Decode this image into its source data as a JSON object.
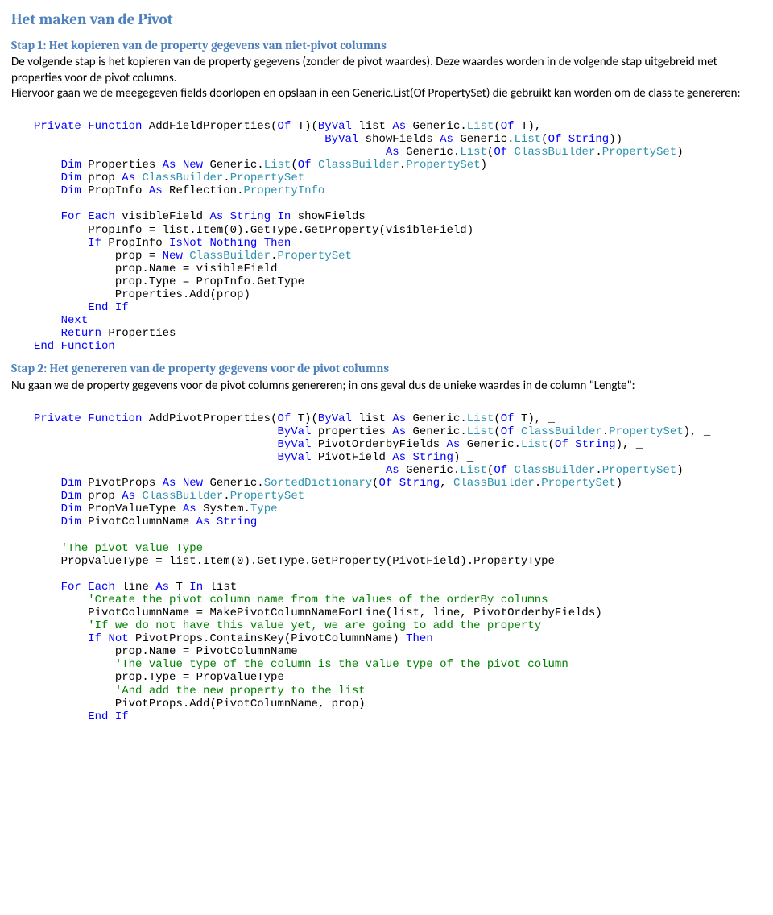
{
  "h2": "Het maken van de Pivot",
  "s1_h3": "Stap 1: Het kopieren van de property gegevens van niet-pivot columns",
  "s1_p": "De volgende stap is het kopieren van de property gegevens (zonder de pivot waardes). Deze waardes worden in de volgende stap uitgebreid met properties voor de pivot columns.\nHiervoor gaan we de meegegeven fields doorlopen en opslaan in een Generic.List(Of PropertySet) die gebruikt kan worden om de class te genereren:",
  "s2_h3": "Stap 2: Het genereren van de property gegevens voor de pivot columns",
  "s2_p": "Nu gaan we de property gegevens voor de pivot columns genereren; in ons geval dus de unieke waardes in de column \"Lengte\":",
  "c1": {
    "l1_a": "Private",
    "l1_b": "Function",
    "l1_c": " AddFieldProperties(",
    "l1_d": "Of",
    "l1_e": " T)(",
    "l1_f": "ByVal",
    "l1_g": " list ",
    "l1_h": "As",
    "l1_i": " Generic.",
    "l1_j": "List",
    "l1_k": "(",
    "l1_l": "Of",
    "l1_m": " T), _",
    "l2_a": "ByVal",
    "l2_b": " showFields ",
    "l2_c": "As",
    "l2_d": " Generic.",
    "l2_e": "List",
    "l2_f": "(",
    "l2_g": "Of",
    "l2_h": " ",
    "l2_i": "String",
    "l2_j": ")) _",
    "l3_a": "As",
    "l3_b": " Generic.",
    "l3_c": "List",
    "l3_d": "(",
    "l3_e": "Of",
    "l3_f": " ",
    "l3_g": "ClassBuilder",
    "l3_h": ".",
    "l3_i": "PropertySet",
    "l3_j": ")",
    "l4_a": "Dim",
    "l4_b": " Properties ",
    "l4_c": "As",
    "l4_d": " ",
    "l4_e": "New",
    "l4_f": " Generic.",
    "l4_g": "List",
    "l4_h": "(",
    "l4_i": "Of",
    "l4_j": " ",
    "l4_k": "ClassBuilder",
    "l4_l": ".",
    "l4_m": "PropertySet",
    "l4_n": ")",
    "l5_a": "Dim",
    "l5_b": " prop ",
    "l5_c": "As",
    "l5_d": " ",
    "l5_e": "ClassBuilder",
    "l5_f": ".",
    "l5_g": "PropertySet",
    "l6_a": "Dim",
    "l6_b": " PropInfo ",
    "l6_c": "As",
    "l6_d": " Reflection.",
    "l6_e": "PropertyInfo",
    "l7_a": "For",
    "l7_b": " ",
    "l7_c": "Each",
    "l7_d": " visibleField ",
    "l7_e": "As",
    "l7_f": " ",
    "l7_g": "String",
    "l7_h": " ",
    "l7_i": "In",
    "l7_j": " showFields",
    "l8": "PropInfo = list.Item(0).GetType.GetProperty(visibleField)",
    "l9_a": "If",
    "l9_b": " PropInfo ",
    "l9_c": "IsNot",
    "l9_d": " ",
    "l9_e": "Nothing",
    "l9_f": " ",
    "l9_g": "Then",
    "l10_a": "prop = ",
    "l10_b": "New",
    "l10_c": " ",
    "l10_d": "ClassBuilder",
    "l10_e": ".",
    "l10_f": "PropertySet",
    "l11": "prop.Name = visibleField",
    "l12": "prop.Type = PropInfo.GetType",
    "l13": "Properties.Add(prop)",
    "l14_a": "End",
    "l14_b": " ",
    "l14_c": "If",
    "l15": "Next",
    "l16_a": "Return",
    "l16_b": " Properties",
    "l17_a": "End",
    "l17_b": " ",
    "l17_c": "Function"
  },
  "c2": {
    "l1_a": "Private",
    "l1_b": "Function",
    "l1_c": " AddPivotProperties(",
    "l1_d": "Of",
    "l1_e": " T)(",
    "l1_f": "ByVal",
    "l1_g": " list ",
    "l1_h": "As",
    "l1_i": " Generic.",
    "l1_j": "List",
    "l1_k": "(",
    "l1_l": "Of",
    "l1_m": " T), _",
    "l2_a": "ByVal",
    "l2_b": " properties ",
    "l2_c": "As",
    "l2_d": " Generic.",
    "l2_e": "List",
    "l2_f": "(",
    "l2_g": "Of",
    "l2_h": " ",
    "l2_i": "ClassBuilder",
    "l2_j": ".",
    "l2_k": "PropertySet",
    "l2_l": "), _",
    "l3_a": "ByVal",
    "l3_b": " PivotOrderbyFields ",
    "l3_c": "As",
    "l3_d": " Generic.",
    "l3_e": "List",
    "l3_f": "(",
    "l3_g": "Of",
    "l3_h": " ",
    "l3_i": "String",
    "l3_j": "), _",
    "l4_a": "ByVal",
    "l4_b": " PivotField ",
    "l4_c": "As",
    "l4_d": " ",
    "l4_e": "String",
    "l4_f": ") _",
    "l5_a": "As",
    "l5_b": " Generic.",
    "l5_c": "List",
    "l5_d": "(",
    "l5_e": "Of",
    "l5_f": " ",
    "l5_g": "ClassBuilder",
    "l5_h": ".",
    "l5_i": "PropertySet",
    "l5_j": ")",
    "l6_a": "Dim",
    "l6_b": " PivotProps ",
    "l6_c": "As",
    "l6_d": " ",
    "l6_e": "New",
    "l6_f": " Generic.",
    "l6_g": "SortedDictionary",
    "l6_h": "(",
    "l6_i": "Of",
    "l6_j": " ",
    "l6_k": "String",
    "l6_l": ", ",
    "l6_m": "ClassBuilder",
    "l6_n": ".",
    "l6_o": "PropertySet",
    "l6_p": ")",
    "l7_a": "Dim",
    "l7_b": " prop ",
    "l7_c": "As",
    "l7_d": " ",
    "l7_e": "ClassBuilder",
    "l7_f": ".",
    "l7_g": "PropertySet",
    "l8_a": "Dim",
    "l8_b": " PropValueType ",
    "l8_c": "As",
    "l8_d": " System.",
    "l8_e": "Type",
    "l9_a": "Dim",
    "l9_b": " PivotColumnName ",
    "l9_c": "As",
    "l9_d": " ",
    "l9_e": "String",
    "l10": "'The pivot value Type",
    "l11": "PropValueType = list.Item(0).GetType.GetProperty(PivotField).PropertyType",
    "l12_a": "For",
    "l12_b": " ",
    "l12_c": "Each",
    "l12_d": " line ",
    "l12_e": "As",
    "l12_f": " T ",
    "l12_g": "In",
    "l12_h": " list",
    "l13": "'Create the pivot column name from the values of the orderBy columns",
    "l14": "PivotColumnName = MakePivotColumnNameForLine(list, line, PivotOrderbyFields)",
    "l15": "'If we do not have this value yet, we are going to add the property",
    "l16_a": "If",
    "l16_b": " ",
    "l16_c": "Not",
    "l16_d": " PivotProps.ContainsKey(PivotColumnName) ",
    "l16_e": "Then",
    "l17": "prop.Name = PivotColumnName",
    "l18": "'The value type of the column is the value type of the pivot column",
    "l19": "prop.Type = PropValueType",
    "l20": "'And add the new property to the list",
    "l21": "PivotProps.Add(PivotColumnName, prop)",
    "l22_a": "End",
    "l22_b": " ",
    "l22_c": "If"
  }
}
